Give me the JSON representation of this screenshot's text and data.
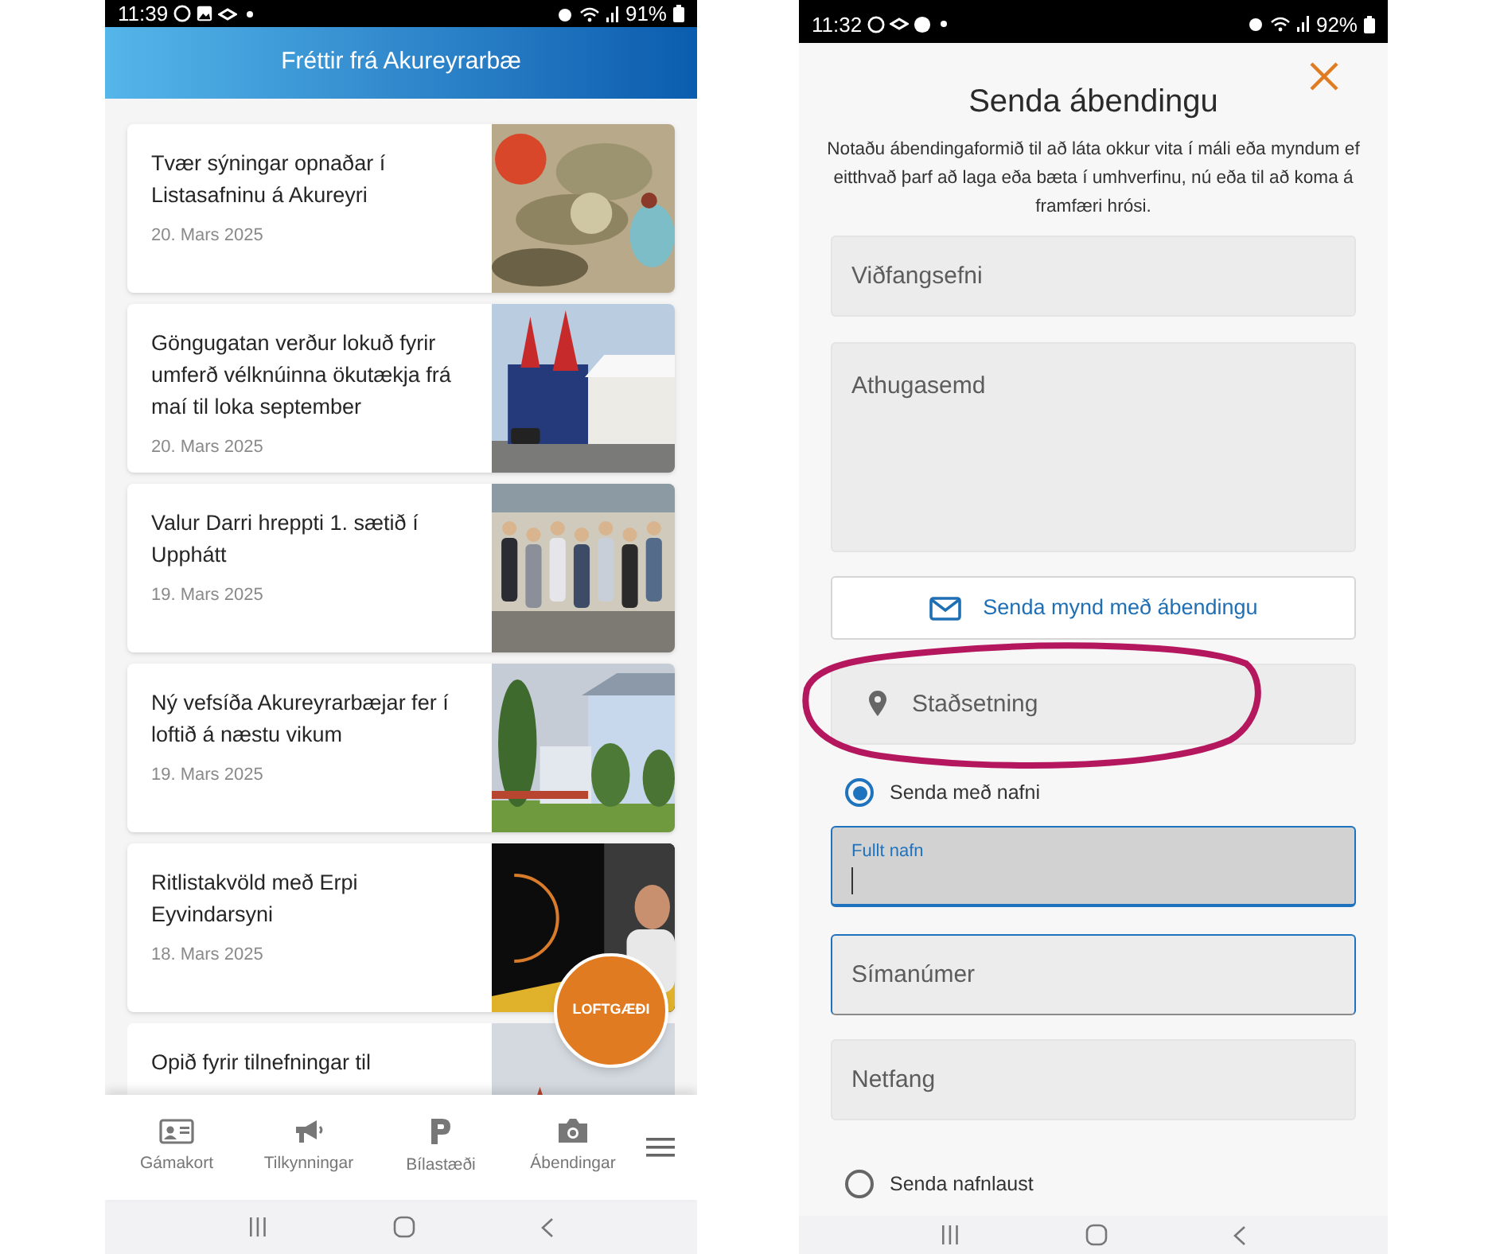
{
  "left_screen": {
    "status_bar": {
      "time": "11:39",
      "battery": "91%"
    },
    "header": {
      "title": "Fréttir frá Akureyrarbæ"
    },
    "news": [
      {
        "title": "Tvær sýningar opnaðar í Listasafninu á Akureyri",
        "date": "20. Mars 2025"
      },
      {
        "title": "Göngugatan verður lokuð fyrir umferð vélknúinna ökutækja frá maí til loka september",
        "date": "20. Mars 2025"
      },
      {
        "title": "Valur Darri hreppti 1. sætið í Upphátt",
        "date": "19. Mars 2025"
      },
      {
        "title": "Ný vefsíða Akureyrarbæjar fer í loftið á næstu vikum",
        "date": "19. Mars 2025"
      },
      {
        "title": "Ritlistakvöld með Erpi Eyvindarsyni",
        "date": "18. Mars 2025"
      },
      {
        "title": "Opið fyrir tilnefningar til"
      }
    ],
    "floating_button": {
      "label": "LOFTGÆÐI"
    },
    "bottom_nav": [
      {
        "kind": "card",
        "label": "Gámakort"
      },
      {
        "kind": "megaphone",
        "label": "Tilkynningar"
      },
      {
        "kind": "parking",
        "label": "Bílastæði"
      },
      {
        "kind": "camera",
        "label": "Ábendingar"
      },
      {
        "kind": "menu"
      }
    ]
  },
  "right_screen": {
    "status_bar": {
      "time": "11:32",
      "battery": "92%"
    },
    "title": "Senda ábendingu",
    "intro": "Notaðu ábendingaformið til að láta okkur vita í máli eða myndum ef eitthvað þarf að laga eða bæta í umhverfinu, nú eða til að koma á framfæri hrósi.",
    "form": [
      {
        "kind": "field",
        "placeholder": "Viðfangsefni",
        "focused": false,
        "outlined": false
      },
      {
        "kind": "textarea",
        "placeholder": "Athugasemd"
      },
      {
        "kind": "button",
        "label": "Senda mynd með ábendingu"
      },
      {
        "kind": "location",
        "placeholder": "Staðsetning"
      },
      {
        "kind": "radio",
        "label": "Senda með nafni",
        "selected": true
      },
      {
        "kind": "field",
        "label": "Fullt nafn",
        "focused": true,
        "outlined": true
      },
      {
        "kind": "field",
        "placeholder": "Símanúmer",
        "focused": false,
        "outlined": true
      },
      {
        "kind": "field",
        "placeholder": "Netfang",
        "focused": false,
        "outlined": false
      },
      {
        "kind": "radio",
        "label": "Senda nafnlaust",
        "selected": false
      }
    ]
  },
  "annotation": {
    "kind": "ellipse",
    "color": "#b5175f"
  }
}
